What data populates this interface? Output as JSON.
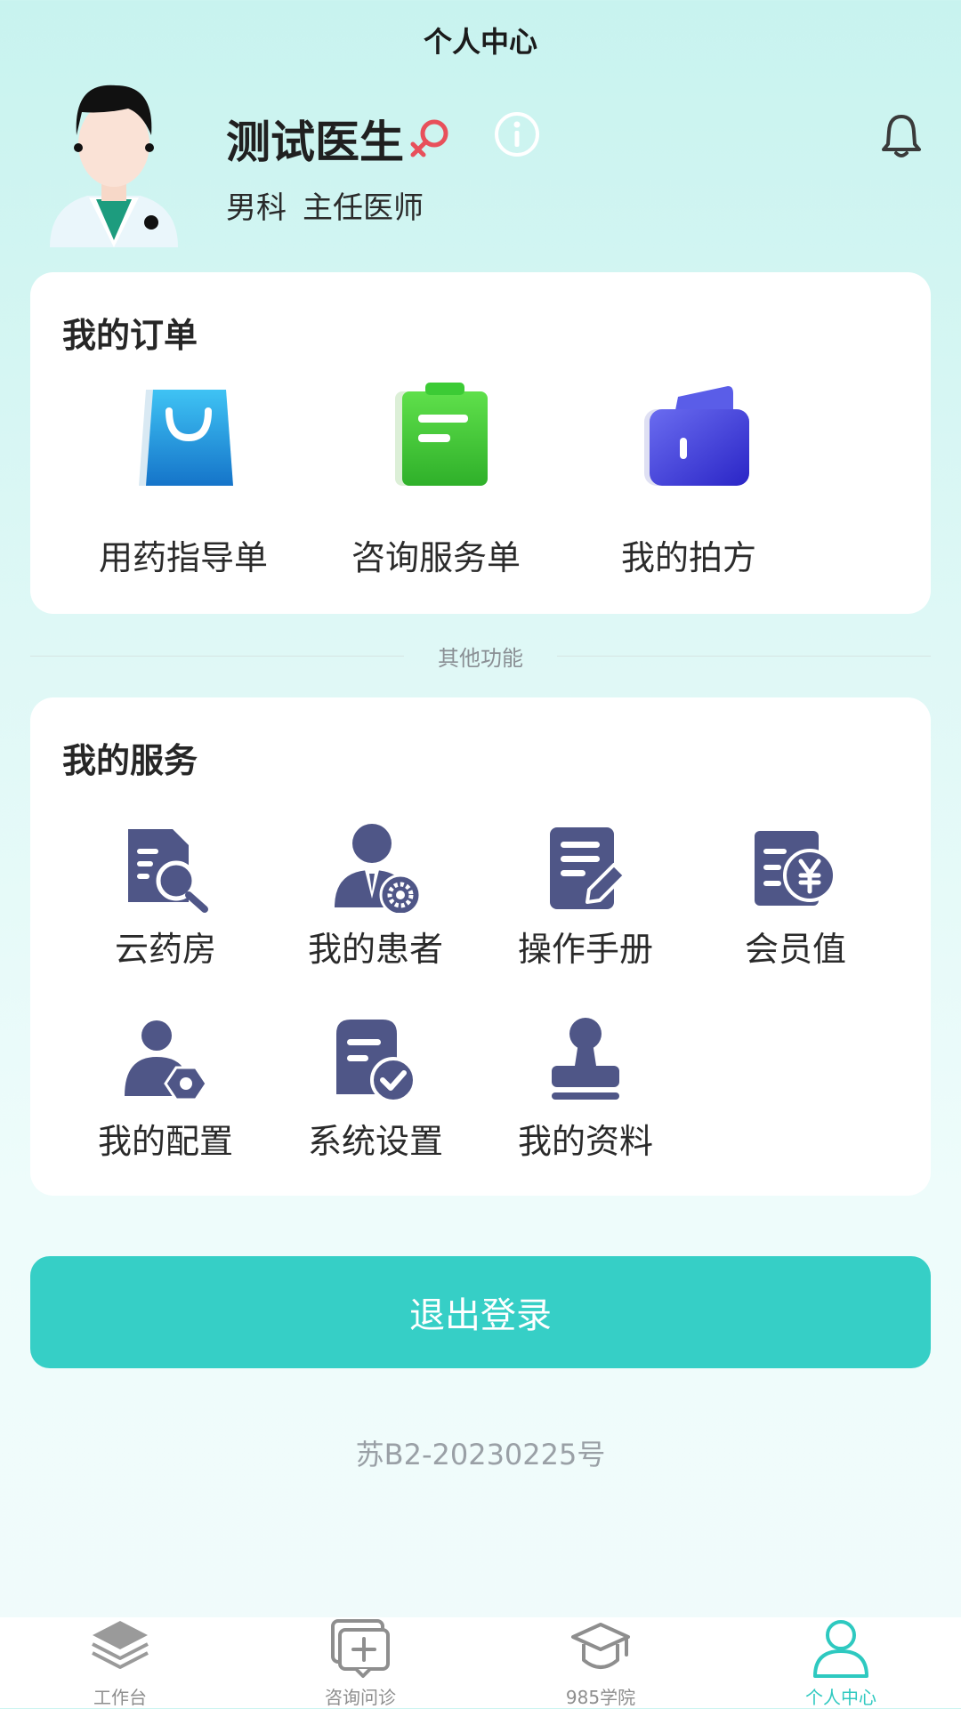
{
  "header": {
    "title": "个人中心"
  },
  "profile": {
    "name": "测试医生",
    "department": "男科",
    "position": "主任医师",
    "gender_icon": "female-symbol-icon",
    "info_icon": "info-circle-icon",
    "bell_icon": "bell-icon"
  },
  "orders": {
    "title": "我的订单",
    "items": [
      {
        "label": "用药指导单",
        "icon": "shopping-bag-icon"
      },
      {
        "label": "咨询服务单",
        "icon": "clipboard-icon"
      },
      {
        "label": "我的拍方",
        "icon": "wallet-icon"
      }
    ]
  },
  "divider": {
    "label": "其他功能"
  },
  "services": {
    "title": "我的服务",
    "items": [
      {
        "label": "云药房",
        "icon": "document-search-icon"
      },
      {
        "label": "我的患者",
        "icon": "doctor-gear-icon"
      },
      {
        "label": "操作手册",
        "icon": "document-edit-icon"
      },
      {
        "label": "会员值",
        "icon": "document-yen-icon"
      },
      {
        "label": "我的配置",
        "icon": "user-settings-icon"
      },
      {
        "label": "系统设置",
        "icon": "document-check-icon"
      },
      {
        "label": "我的资料",
        "icon": "stamp-icon"
      }
    ]
  },
  "logout": {
    "label": "退出登录"
  },
  "footer": {
    "license": "苏B2-20230225号"
  },
  "nav": {
    "items": [
      {
        "label": "工作台",
        "icon": "layers-icon",
        "active": false
      },
      {
        "label": "咨询问诊",
        "icon": "chat-plus-icon",
        "active": false
      },
      {
        "label": "985学院",
        "icon": "graduation-cap-icon",
        "active": false
      },
      {
        "label": "个人中心",
        "icon": "user-icon",
        "active": true
      }
    ]
  },
  "colors": {
    "accent": "#36cfc6",
    "service_icon": "#4f5687",
    "female_symbol": "#e8505b"
  }
}
